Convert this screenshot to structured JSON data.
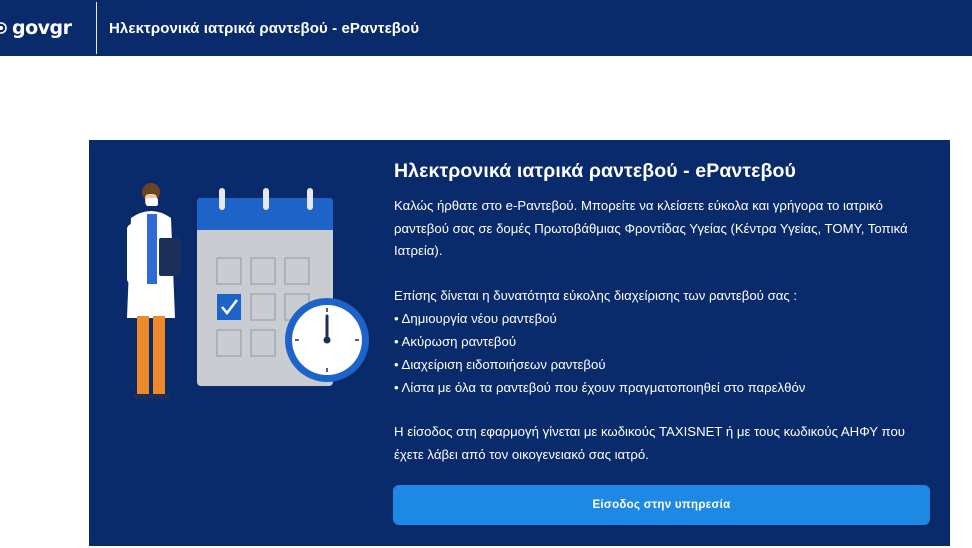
{
  "header": {
    "logo_text": "gov",
    "logo_text_accent": "gr",
    "app_title": "Ηλεκτρονικά ιατρικά ραντεβού - eΡαντεβού"
  },
  "card": {
    "heading": "Ηλεκτρονικά ιατρικά ραντεβού - eΡαντεβού",
    "intro": "Καλώς ήρθατε στο e-Ραντεβού. Μπορείτε να κλείσετε εύκολα και γρήγορα το ιατρικό ραντεβού σας σε δομές Πρωτοβάθμιας Φροντίδας Υγείας (Κέντρα Υγείας, ΤΟΜΥ, Τοπικά Ιατρεία).",
    "features_intro": "Επίσης δίνεται η δυνατότητα εύκολης διαχείρισης των ραντεβού σας :",
    "features": [
      "• Δημιουργία νέου ραντεβού",
      "• Ακύρωση ραντεβού",
      "• Διαχείριση ειδοποιήσεων ραντεβού",
      "• Λίστα με όλα τα ραντεβού που έχουν πραγματοποιηθεί στο παρελθόν"
    ],
    "login_info": "Η είσοδος στη εφαρμογή γίνεται με κωδικούς TAXISNET ή με τους κωδικούς ΑΗΦΥ που έχετε λάβει από τον οικογενειακό σας ιατρό.",
    "cta_label": "Είσοδος στην υπηρεσία"
  },
  "icons": {
    "logo": "greek-emblem-icon",
    "illustration": "doctor-calendar-clock-illustration"
  },
  "colors": {
    "header_bg": "#0a2b6b",
    "card_bg": "#0a2b6b",
    "cta_bg": "#1e88e5",
    "page_bg": "#ffffff"
  }
}
